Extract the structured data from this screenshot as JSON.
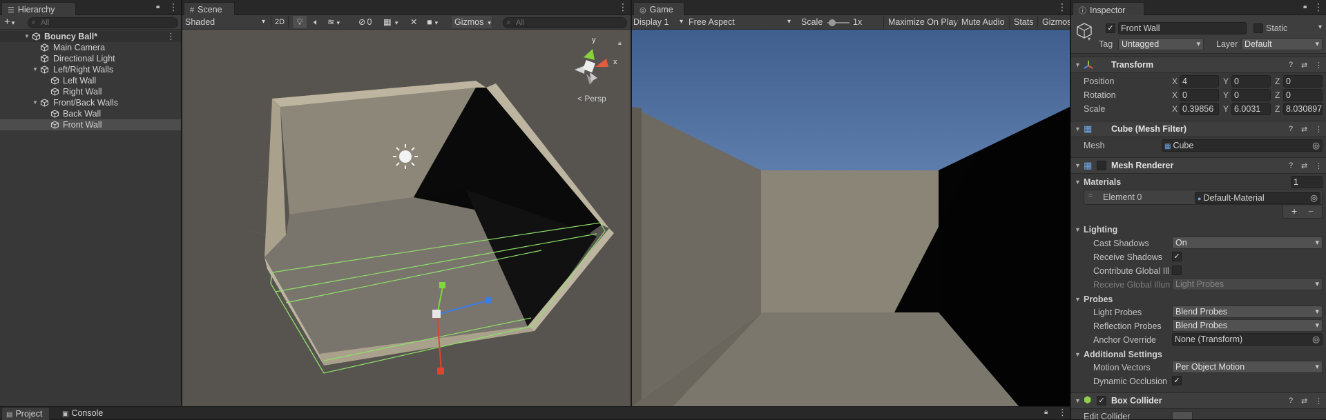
{
  "hierarchy": {
    "tab": "Hierarchy",
    "search_placeholder": "All",
    "items": [
      {
        "label": "Bouncy Ball*"
      },
      {
        "label": "Main Camera"
      },
      {
        "label": "Directional Light"
      },
      {
        "label": "Left/Right Walls"
      },
      {
        "label": "Left Wall"
      },
      {
        "label": "Right Wall"
      },
      {
        "label": "Front/Back Walls"
      },
      {
        "label": "Back Wall"
      },
      {
        "label": "Front Wall"
      }
    ]
  },
  "scene": {
    "tab": "Scene",
    "shading": "Shaded",
    "mode_2d": "2D",
    "fx_count": "0",
    "gizmos": "Gizmos",
    "search_placeholder": "All",
    "persp": "Persp",
    "gizmo_axes": {
      "y": "y",
      "x": "x"
    }
  },
  "game": {
    "tab": "Game",
    "display": "Display 1",
    "aspect": "Free Aspect",
    "scale_label": "Scale",
    "scale_value": "1x",
    "scale_fraction": 0.1,
    "maximize": "Maximize On Play",
    "mute": "Mute Audio",
    "stats": "Stats",
    "gizmos": "Gizmos"
  },
  "inspector": {
    "tab": "Inspector",
    "object_name": "Front Wall",
    "static_label": "Static",
    "tag_label": "Tag",
    "tag_value": "Untagged",
    "layer_label": "Layer",
    "layer_value": "Default",
    "transform": {
      "title": "Transform",
      "position_label": "Position",
      "rotation_label": "Rotation",
      "scale_label": "Scale",
      "position": {
        "x": "4",
        "y": "0",
        "z": "0"
      },
      "rotation": {
        "x": "0",
        "y": "0",
        "z": "0"
      },
      "scale": {
        "x": "0.39856",
        "y": "6.0031",
        "z": "8.030897"
      },
      "axis_x": "X",
      "axis_y": "Y",
      "axis_z": "Z"
    },
    "mesh_filter": {
      "title": "Cube (Mesh Filter)",
      "mesh_label": "Mesh",
      "mesh_value": "Cube"
    },
    "mesh_renderer": {
      "title": "Mesh Renderer",
      "materials_label": "Materials",
      "materials_count": "1",
      "element_label": "Element 0",
      "element_value": "Default-Material",
      "lighting_label": "Lighting",
      "cast_shadows_label": "Cast Shadows",
      "cast_shadows_value": "On",
      "receive_shadows_label": "Receive Shadows",
      "contribute_gi_label": "Contribute Global Ill",
      "receive_gi_label": "Receive Global Illun",
      "receive_gi_value": "Light Probes",
      "probes_label": "Probes",
      "light_probes_label": "Light Probes",
      "light_probes_value": "Blend Probes",
      "reflection_probes_label": "Reflection Probes",
      "reflection_probes_value": "Blend Probes",
      "anchor_override_label": "Anchor Override",
      "anchor_override_value": "None (Transform)",
      "additional_label": "Additional Settings",
      "motion_vectors_label": "Motion Vectors",
      "motion_vectors_value": "Per Object Motion",
      "dynamic_occlusion_label": "Dynamic Occlusion"
    },
    "box_collider": {
      "title": "Box Collider",
      "edit_collider_label": "Edit Collider"
    }
  },
  "bottom": {
    "project_tab": "Project",
    "console_tab": "Console"
  }
}
